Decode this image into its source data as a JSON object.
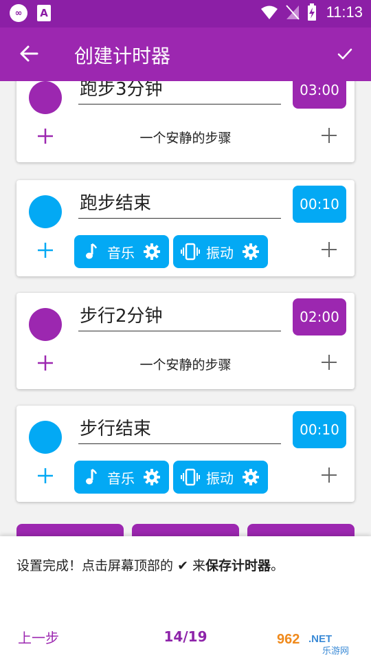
{
  "status": {
    "time": "11:13"
  },
  "appbar": {
    "title": "创建计时器"
  },
  "colors": {
    "purple": "#9c27b0",
    "blue": "#03a9f4"
  },
  "cards": [
    {
      "name": "跑步3分钟",
      "time": "03:00",
      "color": "purple",
      "step": "一个安静的步骤"
    },
    {
      "name": "跑步结束",
      "time": "00:10",
      "color": "blue",
      "pills": [
        "音乐",
        "振动"
      ]
    },
    {
      "name": "步行2分钟",
      "time": "02:00",
      "color": "purple",
      "step": "一个安静的步骤"
    },
    {
      "name": "步行结束",
      "time": "00:10",
      "color": "blue",
      "pills": [
        "音乐",
        "振动"
      ]
    }
  ],
  "sheet": {
    "msg_prefix": "设置完成！点击屏幕顶部的",
    "msg_check": "✔",
    "msg_middle": "来",
    "msg_bold": "保存计时器",
    "msg_suffix": "。",
    "prev_label": "上一步",
    "counter": "14/19"
  },
  "watermark": {
    "brand": "962.NET",
    "sub": "乐游网"
  }
}
